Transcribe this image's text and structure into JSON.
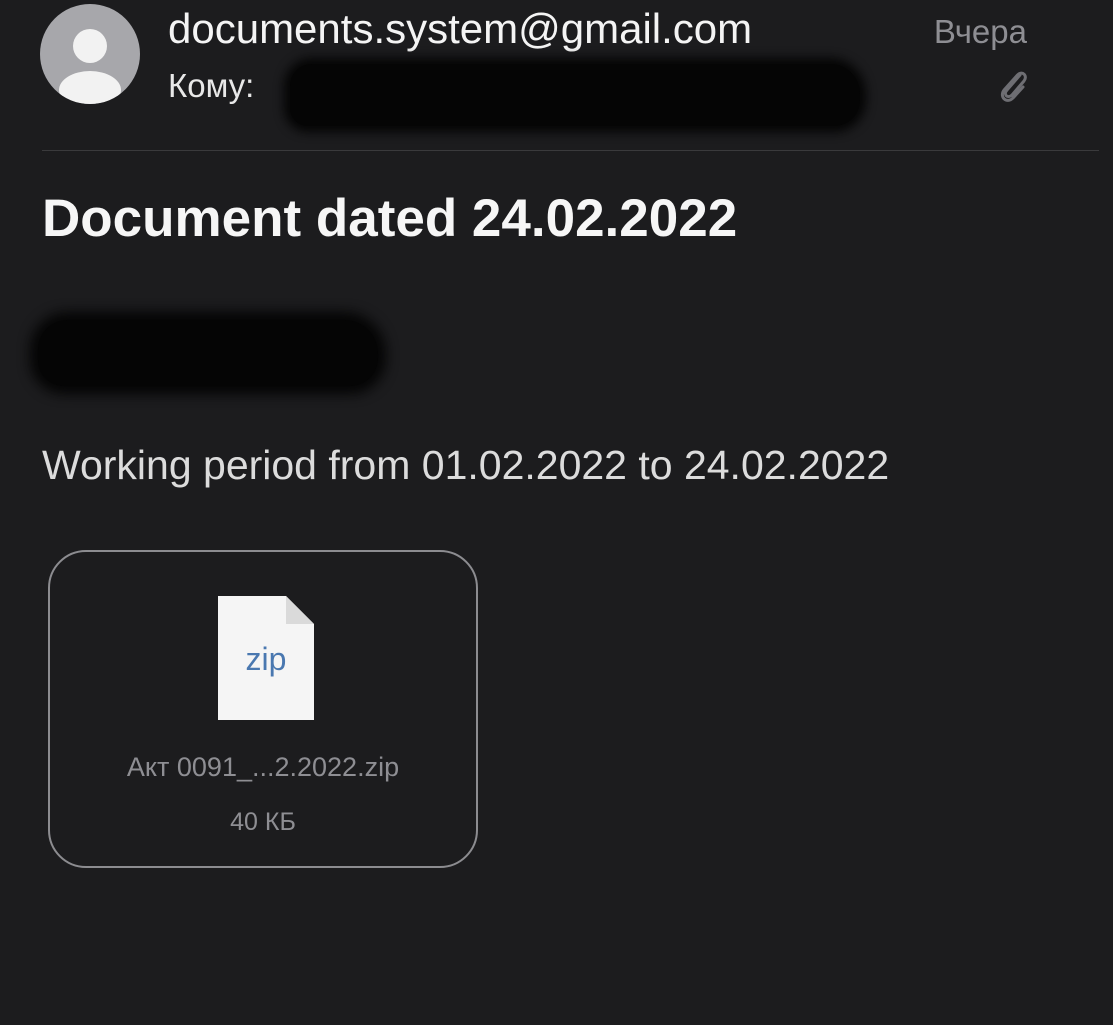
{
  "header": {
    "sender": "documents.system@gmail.com",
    "to_label": "Кому:",
    "date": "Вчера",
    "avatar_icon": "person-placeholder-icon",
    "attachment_indicator_icon": "paperclip-icon"
  },
  "message": {
    "subject": "Document dated 24.02.2022",
    "body": "Working period from 01.02.2022 to 24.02.2022"
  },
  "attachment": {
    "icon": "zip-file-icon",
    "icon_label": "zip",
    "file_name": "Акт 0091_...2.2022.zip",
    "file_size": "40 КБ"
  },
  "colors": {
    "background": "#1c1c1e",
    "secondary_text": "#8e8e93",
    "zip_label": "#4a78b0"
  }
}
